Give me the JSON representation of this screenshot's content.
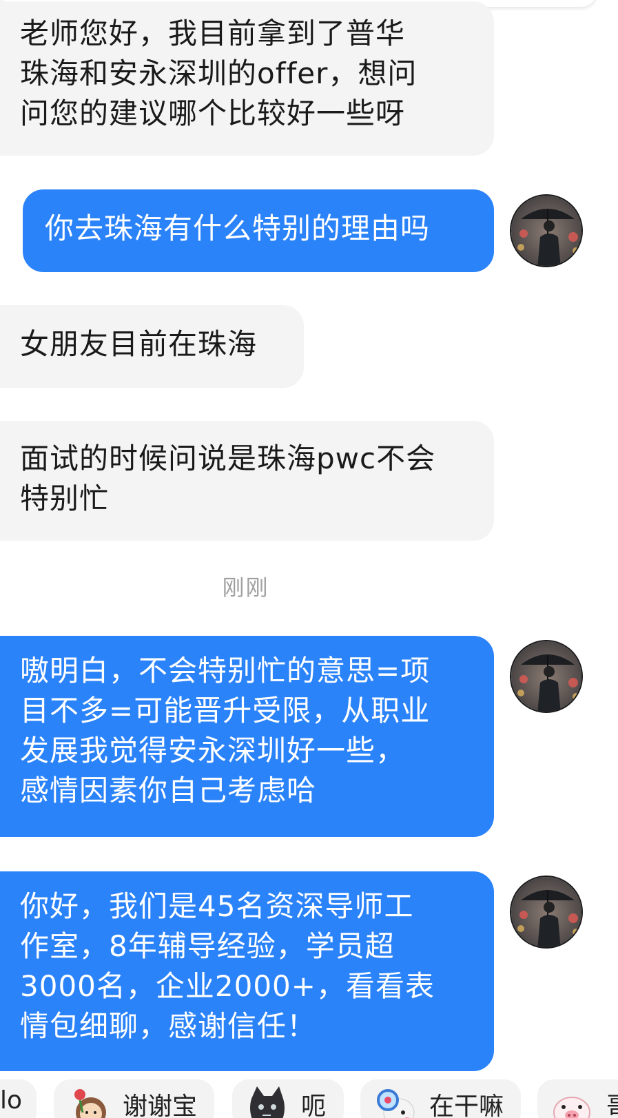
{
  "messages": [
    {
      "sender": "user",
      "text": "老师您好，我目前拿到了普华\n珠海和安永深圳的offer，想问\n问您的建议哪个比较好一些呀"
    },
    {
      "sender": "advisor",
      "text": "你去珠海有什么特别的理由吗"
    },
    {
      "sender": "user",
      "text": "女朋友目前在珠海"
    },
    {
      "sender": "user",
      "text": "面试的时候问说是珠海pwc不会\n特别忙"
    },
    {
      "sender": "advisor",
      "text": "嗷明白，不会特别忙的意思=项\n目不多=可能晋升受限，从职业\n发展我觉得安永深圳好一些，\n感情因素你自己考虑哈"
    },
    {
      "sender": "advisor",
      "text": "你好，我们是45名资深导师工\n作室，8年辅导经验，学员超\n3000名，企业2000+，看看表\n情包细聊，感谢信任！"
    }
  ],
  "timestamp": "刚刚",
  "stickers": [
    {
      "label": "lo",
      "icon": "sticker-partial-icon"
    },
    {
      "label": "谢谢宝",
      "icon": "sticker-girl-rose-icon"
    },
    {
      "label": "呃",
      "icon": "sticker-cat-icon"
    },
    {
      "label": "在干嘛",
      "icon": "sticker-magnifier-icon"
    },
    {
      "label": "哥",
      "icon": "sticker-piglet-icon"
    }
  ],
  "colors": {
    "outgoing_bubble": "#2b83fa",
    "incoming_bubble": "#f4f4f4",
    "timestamp_text": "#a0a0a0"
  }
}
